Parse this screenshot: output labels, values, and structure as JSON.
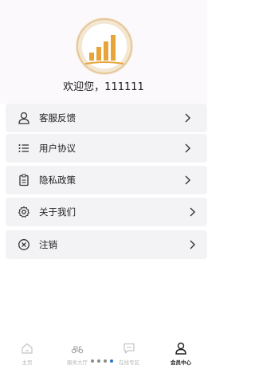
{
  "header": {
    "welcome_text": "欢迎您，111111"
  },
  "menu": [
    {
      "label": "客服反馈",
      "icon": "user-icon"
    },
    {
      "label": "用户协议",
      "icon": "list-icon"
    },
    {
      "label": "隐私政策",
      "icon": "clipboard-icon"
    },
    {
      "label": "关于我们",
      "icon": "gear-icon"
    },
    {
      "label": "注销",
      "icon": "close-circle-icon"
    }
  ],
  "tabbar": [
    {
      "label": "主页",
      "icon": "home-icon",
      "active": false
    },
    {
      "label": "服务大厅",
      "icon": "scooter-icon",
      "active": false
    },
    {
      "label": "在线专区",
      "icon": "chat-icon",
      "active": false
    },
    {
      "label": "会员中心",
      "icon": "user-icon",
      "active": true
    }
  ],
  "page_indicator": {
    "count": 4,
    "active_index": 3
  },
  "colors": {
    "logo_gold": "#e7a43b",
    "background": "#fbf9fb",
    "item_bg": "#f3f3f5",
    "indicator_active": "#2f6fd1"
  }
}
